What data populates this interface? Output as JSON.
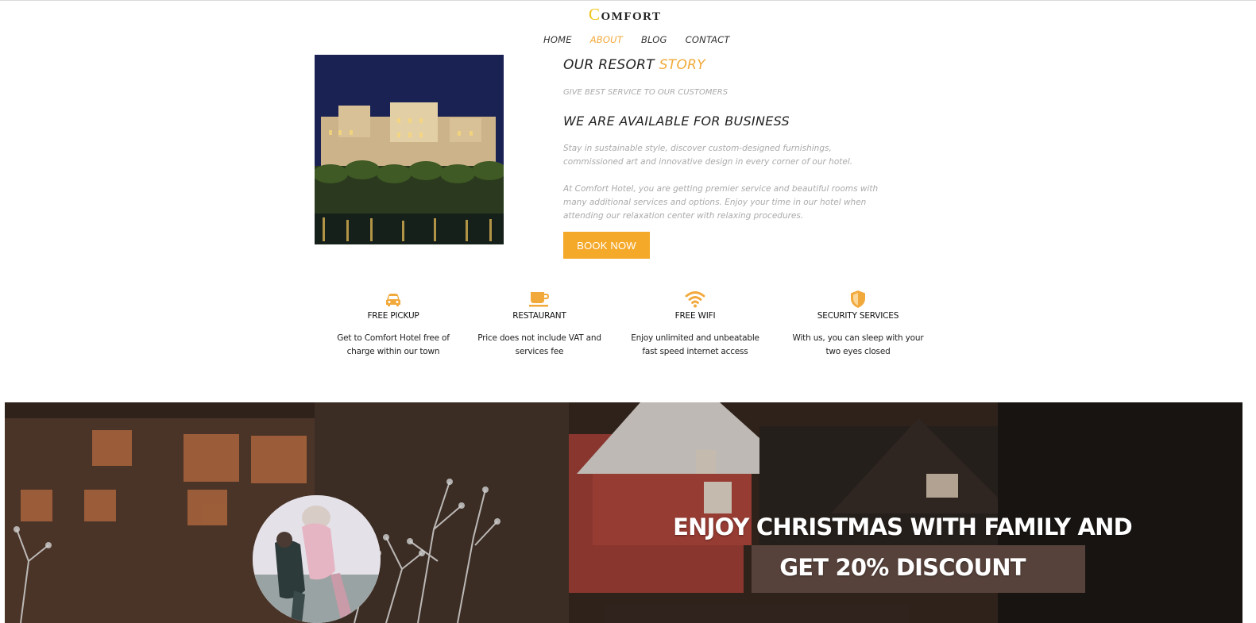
{
  "brand": {
    "initial": "C",
    "rest": "OMFORT"
  },
  "nav": {
    "items": [
      "HOME",
      "ABOUT",
      "BLOG",
      "CONTACT"
    ],
    "active": "ABOUT"
  },
  "about": {
    "title_main": "OUR RESORT",
    "title_accent": "STORY",
    "subtitle": "GIVE BEST SERVICE TO OUR CUSTOMERS",
    "heading": "WE ARE AVAILABLE FOR BUSINESS",
    "paragraph1": "Stay in sustainable style, discover custom-designed furnishings, commissioned art and innovative design in every corner of our hotel.",
    "paragraph2": "At Comfort Hotel, you are getting premier service and beautiful rooms with many additional services and options. Enjoy your time in our hotel when attending our relaxation center with relaxing procedures.",
    "cta": "BOOK NOW"
  },
  "features": [
    {
      "icon": "car-icon",
      "title": "FREE PICKUP",
      "desc": "Get to Comfort Hotel free of charge within our town"
    },
    {
      "icon": "coffee-icon",
      "title": "RESTAURANT",
      "desc": "Price does not include VAT and services fee"
    },
    {
      "icon": "wifi-icon",
      "title": "FREE WIFI",
      "desc": "Enjoy unlimited and unbeatable fast speed internet access"
    },
    {
      "icon": "shield-icon",
      "title": "SECURITY SERVICES",
      "desc": "With us, you can sleep with your two eyes closed"
    }
  ],
  "promo": {
    "line1": "ENJOY CHRISTMAS WITH FAMILY AND",
    "line2": "GET 20% DISCOUNT"
  },
  "colors": {
    "accent": "#f2a93b",
    "button": "#f5a929",
    "text": "#222222",
    "muted": "#aaaaaa"
  }
}
